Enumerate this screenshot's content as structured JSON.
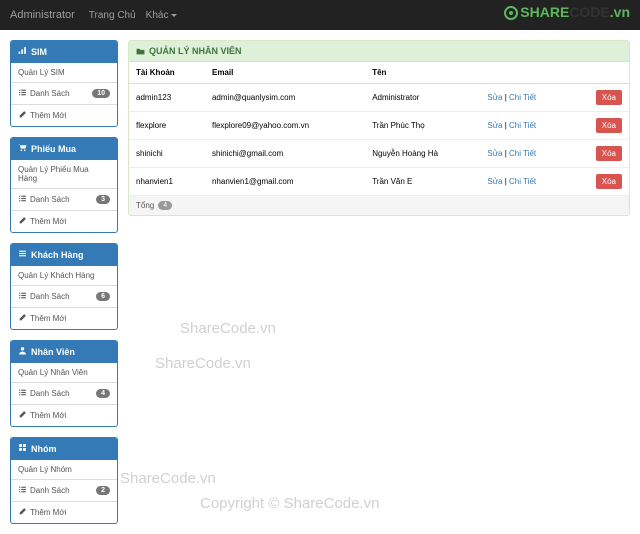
{
  "navbar": {
    "brand": "Administrator",
    "links": [
      "Trang Chủ",
      "Khác"
    ]
  },
  "logo": {
    "text1": "SHARE",
    "text2": "CODE",
    "suffix": ".vn"
  },
  "sidebar": {
    "panels": [
      {
        "title": "SIM",
        "icon": "signal",
        "items": [
          {
            "label": "Quản Lý SIM",
            "icon": "",
            "badge": ""
          },
          {
            "label": "Danh Sách",
            "icon": "list",
            "badge": "10"
          },
          {
            "label": "Thêm Mới",
            "icon": "pencil",
            "badge": ""
          }
        ]
      },
      {
        "title": "Phiếu Mua",
        "icon": "cart",
        "items": [
          {
            "label": "Quản Lý Phiếu Mua Hàng",
            "icon": "",
            "badge": ""
          },
          {
            "label": "Danh Sách",
            "icon": "list",
            "badge": "3"
          },
          {
            "label": "Thêm Mới",
            "icon": "pencil",
            "badge": ""
          }
        ]
      },
      {
        "title": "Khách Hàng",
        "icon": "hamburger",
        "items": [
          {
            "label": "Quản Lý Khách Hàng",
            "icon": "",
            "badge": ""
          },
          {
            "label": "Danh Sách",
            "icon": "list",
            "badge": "6"
          },
          {
            "label": "Thêm Mới",
            "icon": "pencil",
            "badge": ""
          }
        ]
      },
      {
        "title": "Nhân Viên",
        "icon": "user",
        "items": [
          {
            "label": "Quản Lý Nhân Viên",
            "icon": "",
            "badge": ""
          },
          {
            "label": "Danh Sách",
            "icon": "list",
            "badge": "4"
          },
          {
            "label": "Thêm Mới",
            "icon": "pencil",
            "badge": ""
          }
        ]
      },
      {
        "title": "Nhóm",
        "icon": "grid",
        "items": [
          {
            "label": "Quản Lý Nhóm",
            "icon": "",
            "badge": ""
          },
          {
            "label": "Danh Sách",
            "icon": "list",
            "badge": "2"
          },
          {
            "label": "Thêm Mới",
            "icon": "pencil",
            "badge": ""
          }
        ]
      }
    ]
  },
  "main": {
    "title": "QUẢN LÝ NHÂN VIÊN",
    "columns": [
      "Tài Khoản",
      "Email",
      "Tên",
      "",
      ""
    ],
    "rows": [
      {
        "account": "admin123",
        "email": "admin@quanlysim.com",
        "name": "Administrator",
        "edit": "Sửa",
        "detail": "Chi Tiết",
        "delete": "Xóa"
      },
      {
        "account": "flexplore",
        "email": "flexplore09@yahoo.com.vn",
        "name": "Trần Phúc Thọ",
        "edit": "Sửa",
        "detail": "Chi Tiết",
        "delete": "Xóa"
      },
      {
        "account": "shinichi",
        "email": "shinichi@gmail.com",
        "name": "Nguyễn Hoàng Hà",
        "edit": "Sửa",
        "detail": "Chi Tiết",
        "delete": "Xóa"
      },
      {
        "account": "nhanvien1",
        "email": "nhanvien1@gmail.com",
        "name": "Trần Văn E",
        "edit": "Sửa",
        "detail": "Chi Tiết",
        "delete": "Xóa"
      }
    ],
    "footer": {
      "label": "Tổng",
      "count": "4"
    }
  },
  "watermarks": [
    "ShareCode.vn",
    "ShareCode.vn",
    "ShareCode.vn",
    "Copyright © ShareCode.vn"
  ]
}
